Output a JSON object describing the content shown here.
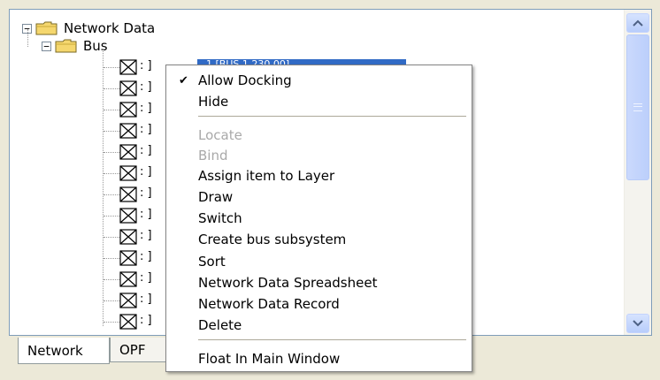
{
  "tree": {
    "root": {
      "label": "Network Data",
      "expander": "−"
    },
    "bus": {
      "label": "Bus",
      "expander": "−"
    },
    "selected_item": "1 [BUS 1        230.00]",
    "leaf_caption": ": ]"
  },
  "tabs": [
    {
      "label": "Network"
    },
    {
      "label": "OPF"
    }
  ],
  "context_menu": {
    "items": [
      {
        "label": "Allow Docking",
        "checked": true,
        "enabled": true
      },
      {
        "label": "Hide",
        "enabled": true
      },
      {
        "label": "Locate",
        "enabled": false
      },
      {
        "label": "Bind",
        "enabled": false
      },
      {
        "label": "Assign item to Layer",
        "enabled": true
      },
      {
        "label": "Draw",
        "enabled": true
      },
      {
        "label": "Switch",
        "enabled": true
      },
      {
        "label": "Create bus subsystem",
        "enabled": true
      },
      {
        "label": "Sort",
        "enabled": true
      },
      {
        "label": "Network Data Spreadsheet",
        "enabled": true
      },
      {
        "label": "Network Data Record",
        "enabled": true
      },
      {
        "label": "Delete",
        "enabled": true
      },
      {
        "label": "Float In Main Window",
        "enabled": true
      }
    ],
    "check_mark": "✔"
  },
  "icons": {
    "folder": "folder-icon",
    "leaf": "unchecked-box-icon",
    "scroll_up": "arrow-up-icon",
    "scroll_down": "arrow-down-icon"
  },
  "colors": {
    "selection": "#316ac5",
    "folder_fill": "#f5d76e",
    "menu_border": "#848484",
    "scroll_button": "#c1d3fb"
  }
}
